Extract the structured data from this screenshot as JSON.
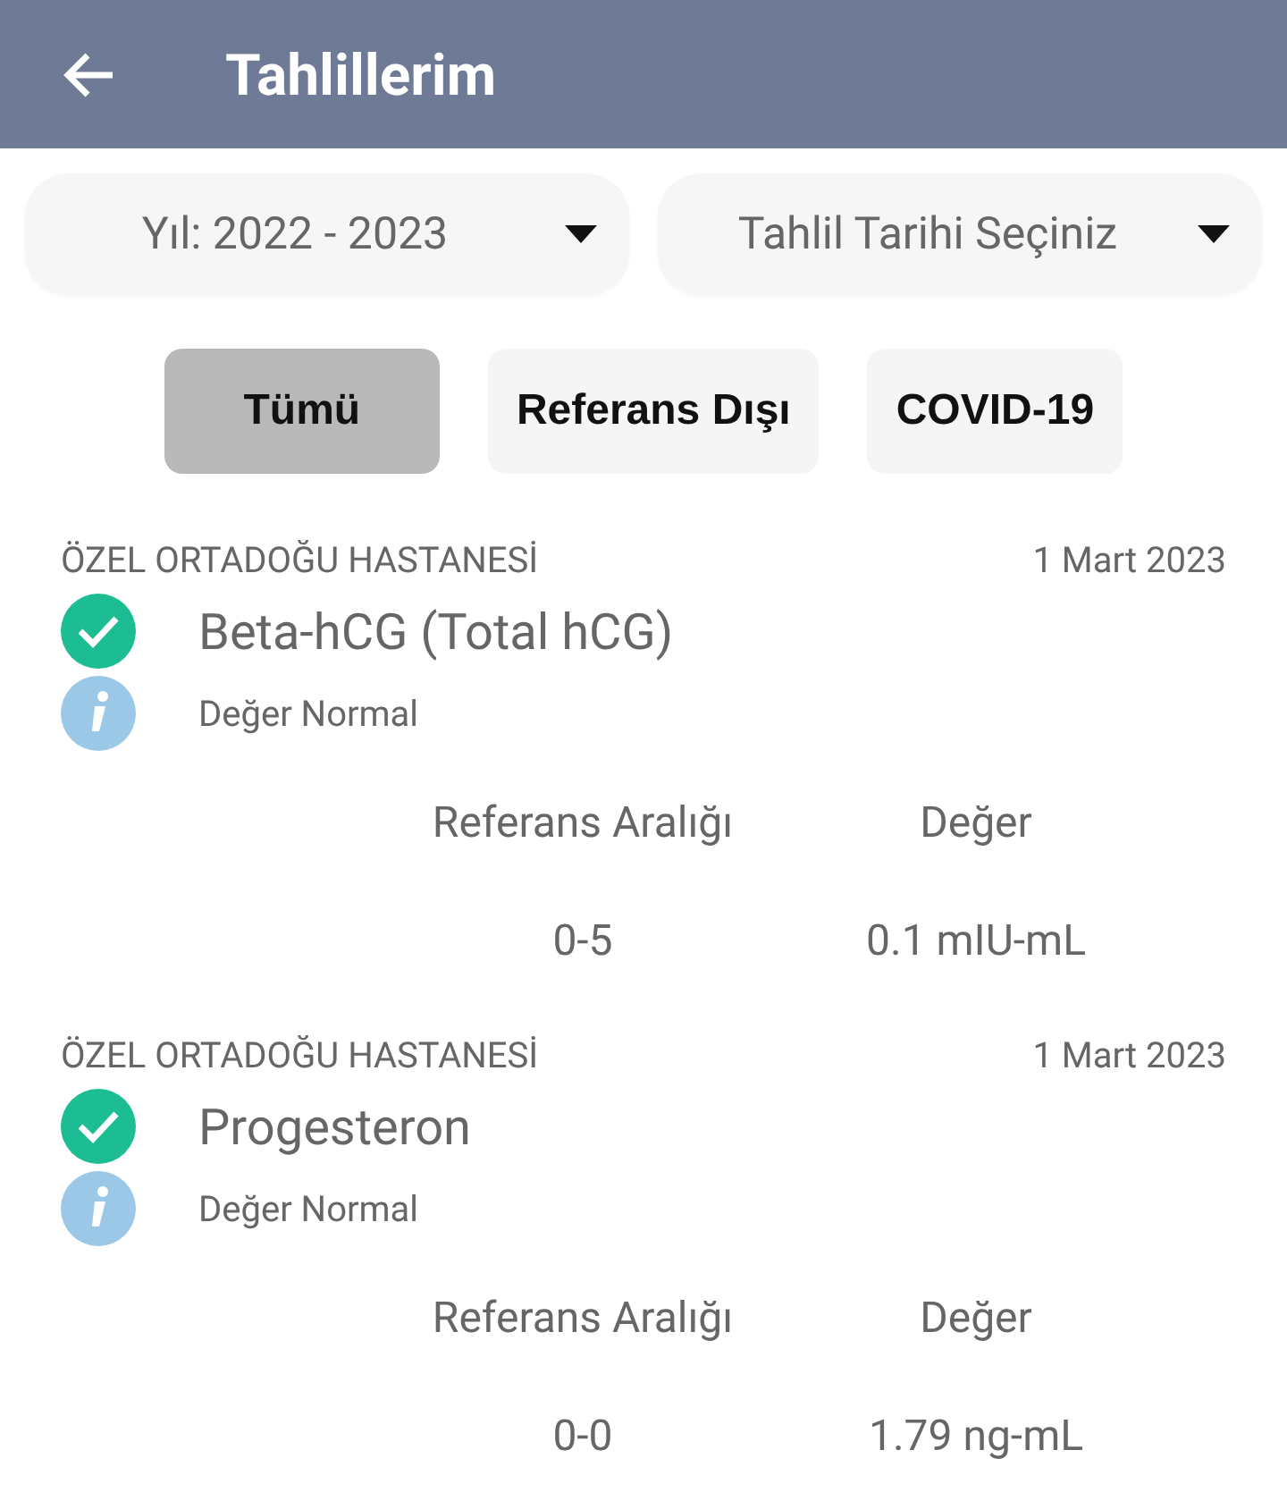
{
  "header": {
    "title": "Tahlillerim"
  },
  "dropdowns": [
    {
      "label": "Yıl: 2022 - 2023"
    },
    {
      "label": "Tahlil Tarihi Seçiniz"
    }
  ],
  "filters": [
    {
      "label": "Tümü",
      "selected": true
    },
    {
      "label": "Referans Dışı",
      "selected": false
    },
    {
      "label": "COVID-19",
      "selected": false
    }
  ],
  "results": [
    {
      "hospital": "ÖZEL ORTADOĞU HASTANESİ",
      "date": "1 Mart 2023",
      "test": "Beta-hCG (Total hCG)",
      "kind": "normal",
      "status": "Değer Normal",
      "reference_heading": "Referans Aralığı",
      "value_heading": "Değer",
      "reference": "0-5",
      "value": "0.1 mIU-mL"
    },
    {
      "hospital": "ÖZEL ORTADOĞU HASTANESİ",
      "date": "1 Mart 2023",
      "test": "Progesteron",
      "kind": "normal",
      "status": "Değer Normal",
      "reference_heading": "Referans Aralığı",
      "value_heading": "Değer",
      "reference": "0-0",
      "value": "1.79 ng-mL"
    }
  ]
}
